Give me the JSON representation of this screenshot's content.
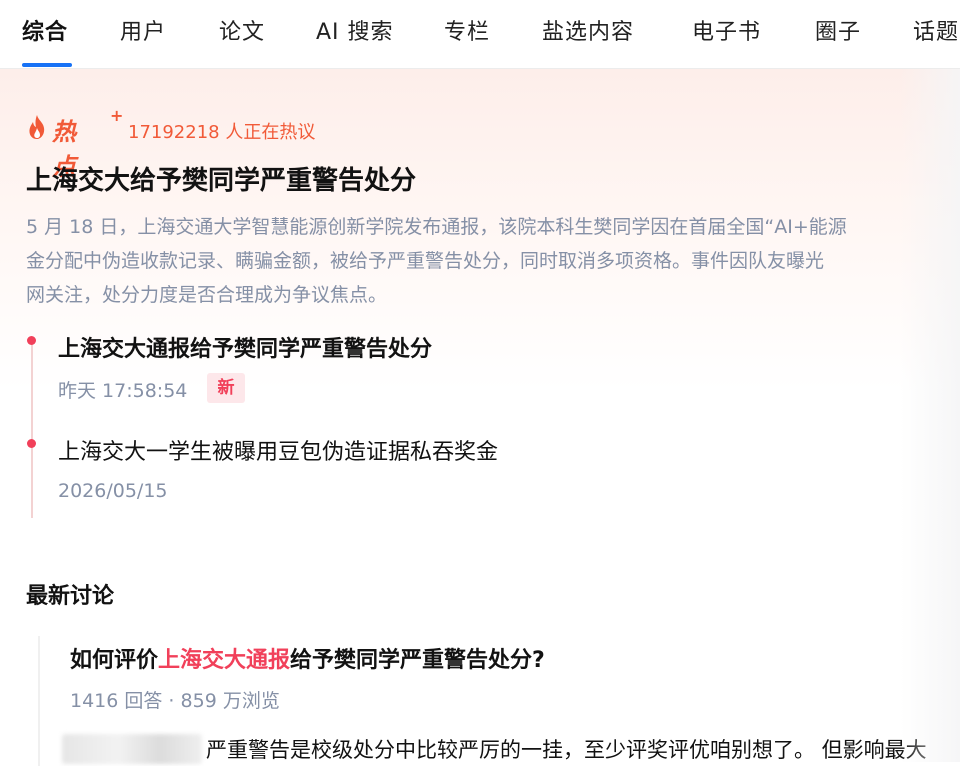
{
  "tabs": [
    {
      "label": "综合",
      "active": true
    },
    {
      "label": "用户"
    },
    {
      "label": "论文"
    },
    {
      "label": "AI 搜索"
    },
    {
      "label": "专栏"
    },
    {
      "label": "盐选内容"
    },
    {
      "label": "电子书"
    },
    {
      "label": "圈子"
    },
    {
      "label": "话题"
    }
  ],
  "hot": {
    "label": "热点",
    "count_text": "17192218 人正在热议",
    "headline": "上海交大给予樊同学严重警告处分",
    "summary_lines": [
      "5 月 18 日，上海交通大学智慧能源创新学院发布通报，该院本科生樊同学因在首届全国“AI+能源",
      "金分配中伪造收款记录、瞒骗金额，被给予严重警告处分，同时取消多项资格。事件因队友曝光",
      "网关注，处分力度是否合理成为争议焦点。"
    ],
    "timeline": [
      {
        "title": "上海交大通报给予樊同学严重警告处分",
        "time": "昨天 17:58:54",
        "badge": "新"
      },
      {
        "title": "上海交大一学生被曝用豆包伪造证据私吞奖金",
        "time": "2026/05/15"
      }
    ]
  },
  "discussion": {
    "section_title": "最新讨论",
    "question_prefix": "如何评价",
    "question_highlight": "上海交大通报",
    "question_suffix": "给予樊同学严重警告处分?",
    "stats": "1416 回答 · 859 万浏览",
    "answer_excerpt": "严重警告是校级处分中比较严厉的一挂，至少评奖评优咱别想了。 但影响最大"
  },
  "colors": {
    "accent_blue": "#1772f6",
    "hot_orange": "#f15a38",
    "highlight_red": "#f1405a",
    "meta_gray": "#8590a6"
  }
}
